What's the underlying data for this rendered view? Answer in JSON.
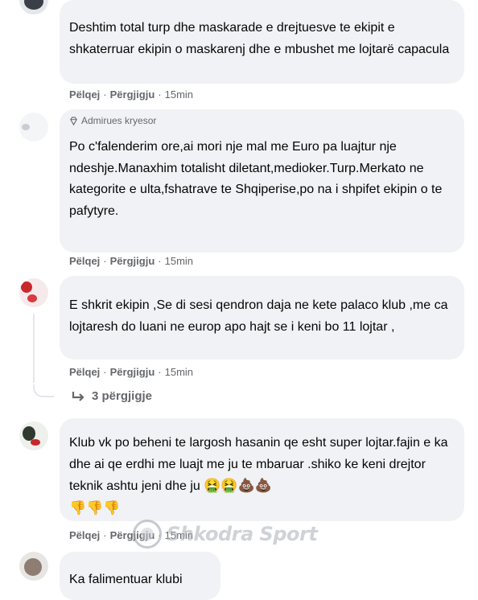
{
  "comments": [
    {
      "text": "Deshtim total turp dhe maskarade e drejtuesve te ekipit e shkaterruar ekipin o maskarenj dhe e mbushet me lojtarë capacula",
      "like": "Pëlqej",
      "reply": "Përgjigju",
      "time": "15min"
    },
    {
      "badge": "Admirues kryesor",
      "text": "Po c'falenderim ore,ai mori nje mal me Euro pa luajtur nje ndeshje.Manaxhim totalisht diletant,medioker.Turp.Merkato ne kategorite e ulta,fshatrave te Shqiperise,po na i shpifet ekipin o te pafytyre.",
      "like": "Pëlqej",
      "reply": "Përgjigju",
      "time": "15min"
    },
    {
      "text": "E shkrit ekipin ,Se di sesi qendron daja ne kete palaco klub ,me ca lojtaresh do luani ne europ apo hajt se i keni bo 11 lojtar ,",
      "like": "Pëlqej",
      "reply": "Përgjigju",
      "time": "15min",
      "replies_label": "3 përgjigje"
    },
    {
      "text": "Klub vk po beheni te largosh hasanin qe esht super lojtar.fajin e ka dhe ai qe erdhi me luajt me ju te mbaruar .shiko ke keni drejtor teknik ashtu jeni dhe ju",
      "emoji_line1": "🤮🤮💩💩",
      "emoji_line2": "👎👎👎",
      "like": "Pëlqej",
      "reply": "Përgjigju",
      "time": "15min"
    },
    {
      "text": "Ka falimentuar klubi"
    }
  ],
  "watermark": "Shkodra Sport",
  "icons": {
    "badge": "diamond-icon",
    "replies": "reply-arrow-icon"
  }
}
